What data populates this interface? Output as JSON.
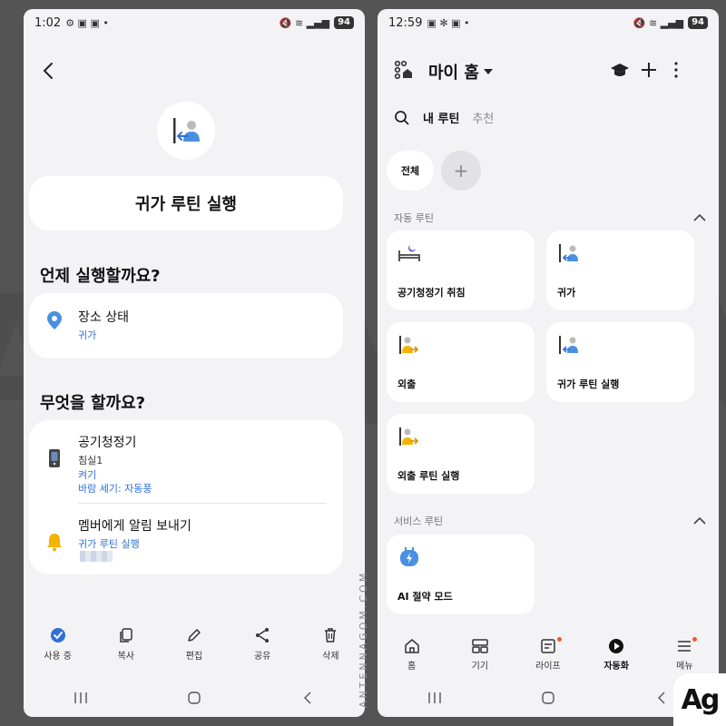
{
  "left": {
    "status": {
      "time": "1:02",
      "battery": "94"
    },
    "title": "귀가 루틴 실행",
    "when_title": "언제 실행할까요?",
    "when_item": {
      "title": "장소 상태",
      "value": "귀가"
    },
    "what_title": "무엇을 할까요?",
    "action1": {
      "title": "공기청정기",
      "room": "침실1",
      "line1": "켜기",
      "line2": "바람 세기: 자동풍"
    },
    "action2": {
      "title": "멤버에게 알림 보내기",
      "line1": "귀가 루틴 실행"
    },
    "toolbar": {
      "using": "사용 중",
      "copy": "복사",
      "edit": "편집",
      "share": "공유",
      "delete": "삭제"
    }
  },
  "right": {
    "status": {
      "time": "12:59",
      "battery": "94"
    },
    "home_title": "마이 홈",
    "tabs": {
      "my_routines": "내 루틴",
      "recommended": "추천"
    },
    "chips": {
      "all": "전체",
      "add": "+"
    },
    "auto_group": "자동 루틴",
    "auto_routines": [
      "공기청정기 취침",
      "귀가",
      "외출",
      "귀가 루틴 실행",
      "외출 루틴 실행"
    ],
    "service_group": "서비스 루틴",
    "service_routines": [
      "AI 절약 모드"
    ],
    "bottom_nav": {
      "home": "홈",
      "devices": "기기",
      "life": "라이프",
      "automation": "자동화",
      "menu": "메뉴"
    }
  },
  "decor": {
    "watermark": "Ag",
    "vertical_text": "ANTENNAGOM.COM",
    "logo": "Ag"
  },
  "colors": {
    "accent_blue": "#2f6fd6",
    "notify_orange": "#f05a2a",
    "icon_blue": "#4a90e2",
    "icon_yellow": "#f5b400"
  }
}
